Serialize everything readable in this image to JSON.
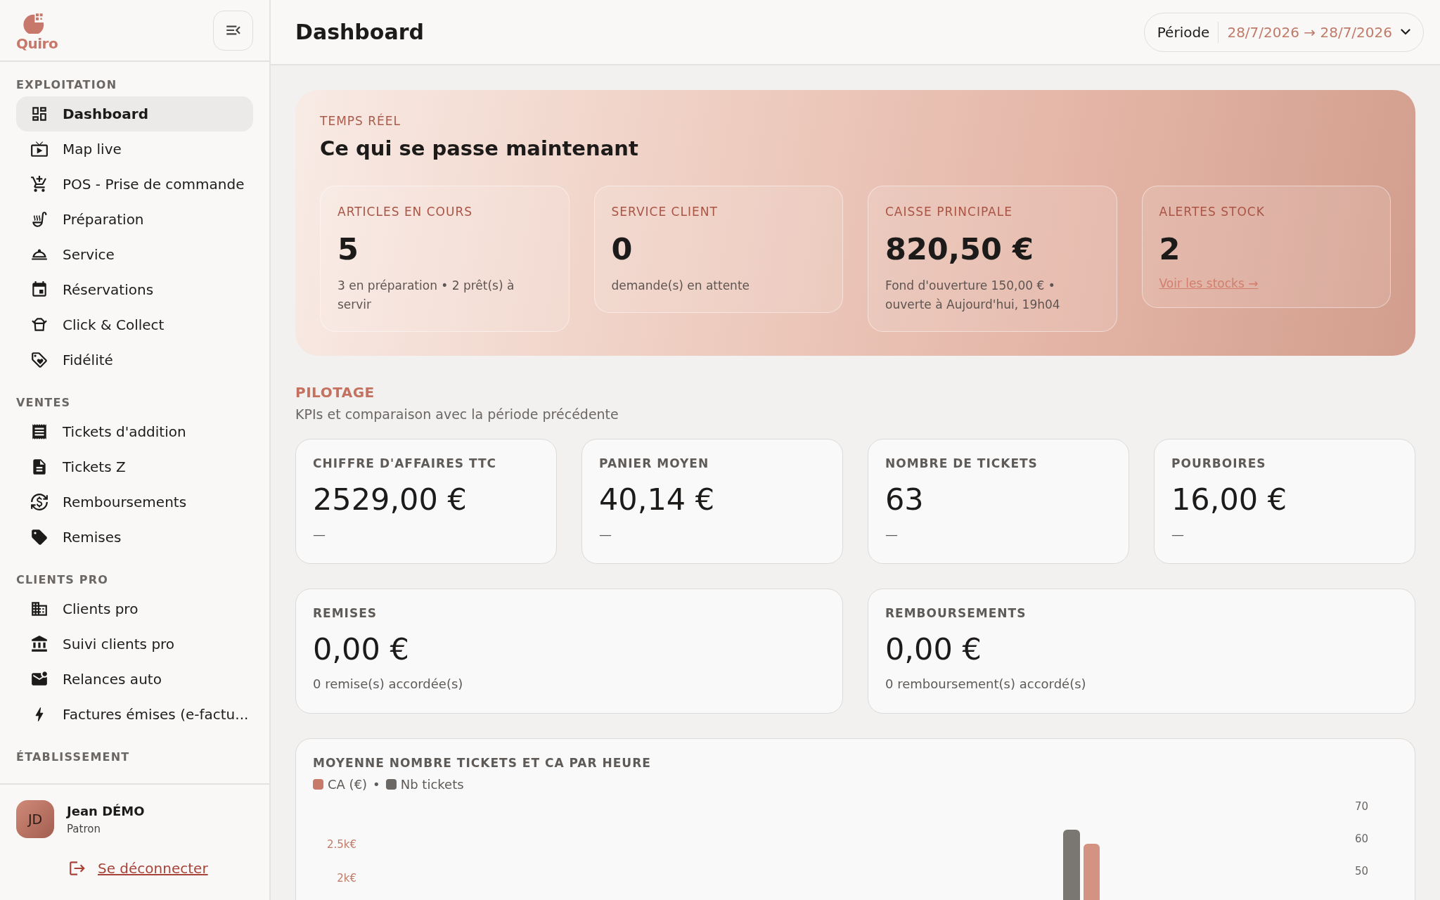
{
  "logo": {
    "text": "Quiro"
  },
  "sidebar": {
    "sections": [
      {
        "title": "EXPLOITATION",
        "items": [
          {
            "label": "Dashboard",
            "selected": true
          },
          {
            "label": "Map live",
            "selected": false
          },
          {
            "label": "POS - Prise de commande",
            "selected": false
          },
          {
            "label": "Préparation",
            "selected": false
          },
          {
            "label": "Service",
            "selected": false
          },
          {
            "label": "Réservations",
            "selected": false
          },
          {
            "label": "Click & Collect",
            "selected": false
          },
          {
            "label": "Fidélité",
            "selected": false
          }
        ]
      },
      {
        "title": "VENTES",
        "items": [
          {
            "label": "Tickets d'addition",
            "selected": false
          },
          {
            "label": "Tickets Z",
            "selected": false
          },
          {
            "label": "Remboursements",
            "selected": false
          },
          {
            "label": "Remises",
            "selected": false
          }
        ]
      },
      {
        "title": "CLIENTS PRO",
        "items": [
          {
            "label": "Clients pro",
            "selected": false
          },
          {
            "label": "Suivi clients pro",
            "selected": false
          },
          {
            "label": "Relances auto",
            "selected": false
          },
          {
            "label": "Factures émises (e-factu...",
            "selected": false
          }
        ]
      },
      {
        "title": "ÉTABLISSEMENT"
      }
    ],
    "user": {
      "initials": "JD",
      "name": "Jean DÉMO",
      "role": "Patron"
    },
    "logout": "Se déconnecter"
  },
  "header": {
    "title": "Dashboard",
    "period_label": "Période",
    "period_value": "28/7/2026 → 28/7/2026"
  },
  "realtime": {
    "eyebrow": "TEMPS RÉEL",
    "title": "Ce qui se passe maintenant",
    "cards": [
      {
        "label": "ARTICLES EN COURS",
        "value": "5",
        "detail": "3 en préparation • 2 prêt(s) à servir",
        "kind": "text"
      },
      {
        "label": "SERVICE CLIENT",
        "value": "0",
        "detail": "demande(s) en attente",
        "kind": "text"
      },
      {
        "label": "CAISSE PRINCIPALE",
        "value": "820,50 €",
        "detail": "Fond d'ouverture 150,00 € • ouverte à Aujourd'hui, 19h04",
        "kind": "text"
      },
      {
        "label": "ALERTES STOCK",
        "value": "2",
        "detail": "Voir les stocks →",
        "kind": "link"
      }
    ]
  },
  "pilotage": {
    "title": "PILOTAGE",
    "subtitle": "KPIs et comparaison avec la période précédente",
    "kpis": [
      {
        "label": "CHIFFRE D'AFFAIRES TTC",
        "value": "2529,00 €",
        "detail": "—"
      },
      {
        "label": "PANIER MOYEN",
        "value": "40,14 €",
        "detail": "—"
      },
      {
        "label": "NOMBRE DE TICKETS",
        "value": "63",
        "detail": "—"
      },
      {
        "label": "POURBOIRES",
        "value": "16,00 €",
        "detail": "—"
      }
    ],
    "wide": [
      {
        "label": "REMISES",
        "value": "0,00 €",
        "detail": "0 remise(s) accordée(s)"
      },
      {
        "label": "REMBOURSEMENTS",
        "value": "0,00 €",
        "detail": "0 remboursement(s) accordé(s)"
      }
    ]
  },
  "chart": {
    "title": "MOYENNE NOMBRE TICKETS ET CA PAR HEURE",
    "legend": [
      {
        "label": "CA (€)",
        "color": "#c87a6a"
      },
      {
        "label": "Nb tickets",
        "color": "#6b6764"
      }
    ],
    "legend_separator": "•",
    "left_axis_labels": [
      "2.5k€",
      "2k€"
    ],
    "right_axis_labels": [
      "70",
      "60",
      "50"
    ]
  }
}
